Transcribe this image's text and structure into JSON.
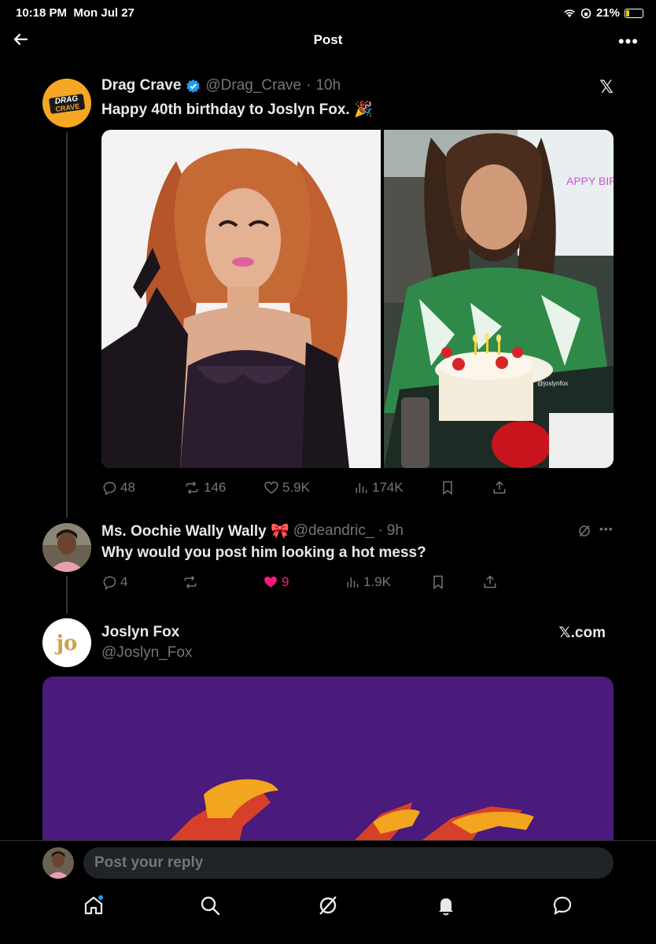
{
  "status_bar": {
    "time": "10:18 PM",
    "date": "Mon Jul 27",
    "battery": "21%",
    "battery_level": 0.21
  },
  "header": {
    "title": "Post"
  },
  "tweet": {
    "author_name": "Drag Crave",
    "author_handle": "@Drag_Crave",
    "dot": "·",
    "time": "10h",
    "avatar_text": [
      "DRAG",
      "CRAVE"
    ],
    "text": "Happy 40th birthday to Joslyn Fox. 🎉",
    "image2_overlay": "APPY BIRTHDAY",
    "image2_watermark": "@joslynfox",
    "stats": {
      "replies": "48",
      "reposts": "146",
      "likes": "5.9K",
      "views": "174K"
    }
  },
  "reply": {
    "author_name": "Ms. Oochie Wally Wally 🎀",
    "author_handle": "@deandric_",
    "dot": "·",
    "time": "9h",
    "text": "Why would you post him looking a hot mess?",
    "stats": {
      "replies": "4",
      "reposts": "",
      "likes": "9",
      "views": "1.9K"
    }
  },
  "quote": {
    "author_name": "Joslyn Fox",
    "author_handle": "@Joslyn_Fox",
    "source": "𝕏.com",
    "avatar_text": "jo"
  },
  "composer": {
    "placeholder": "Post your reply"
  },
  "colors": {
    "like_active": "#f91880",
    "verified": "#1d9bf0",
    "card_bg": "#4a1a7c"
  }
}
